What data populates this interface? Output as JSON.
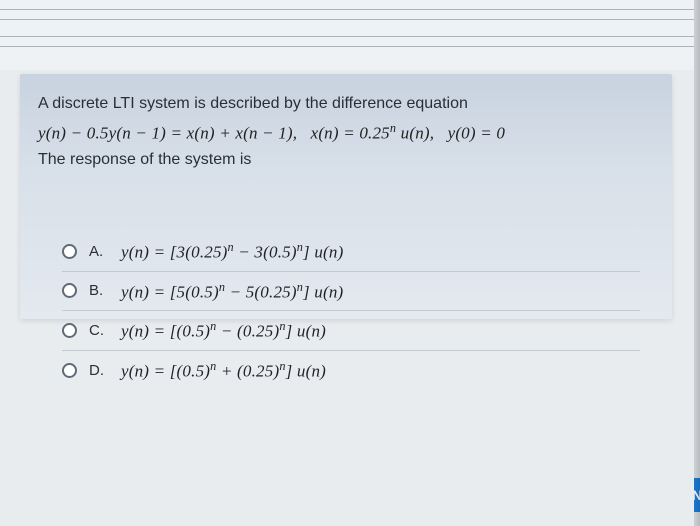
{
  "question": {
    "intro": "A discrete LTI system is described by the difference equation",
    "equation_html": "y(n) − 0.5y(n − 1) = x(n) + x(n − 1),&nbsp;&nbsp;&nbsp;x(n) = 0.25<span class='sup'>n</span>&nbsp;u(n),&nbsp;&nbsp;&nbsp;y(0) = 0",
    "prompt": "The response of the system is"
  },
  "options": [
    {
      "letter": "A.",
      "math_html": "y(n) = [3(0.25)<span class='sup'>n</span> − 3(0.5)<span class='sup'>n</span>] u(n)"
    },
    {
      "letter": "B.",
      "math_html": "y(n) = [5(0.5)<span class='sup'>n</span> − 5(0.25)<span class='sup'>n</span>] u(n)"
    },
    {
      "letter": "C.",
      "math_html": "y(n) = [(0.5)<span class='sup'>n</span> − (0.25)<span class='sup'>n</span>] u(n)"
    },
    {
      "letter": "D.",
      "math_html": "y(n) = [(0.5)<span class='sup'>n</span> + (0.25)<span class='sup'>n</span>] u(n)"
    }
  ],
  "nav": {
    "next_label": "N"
  }
}
